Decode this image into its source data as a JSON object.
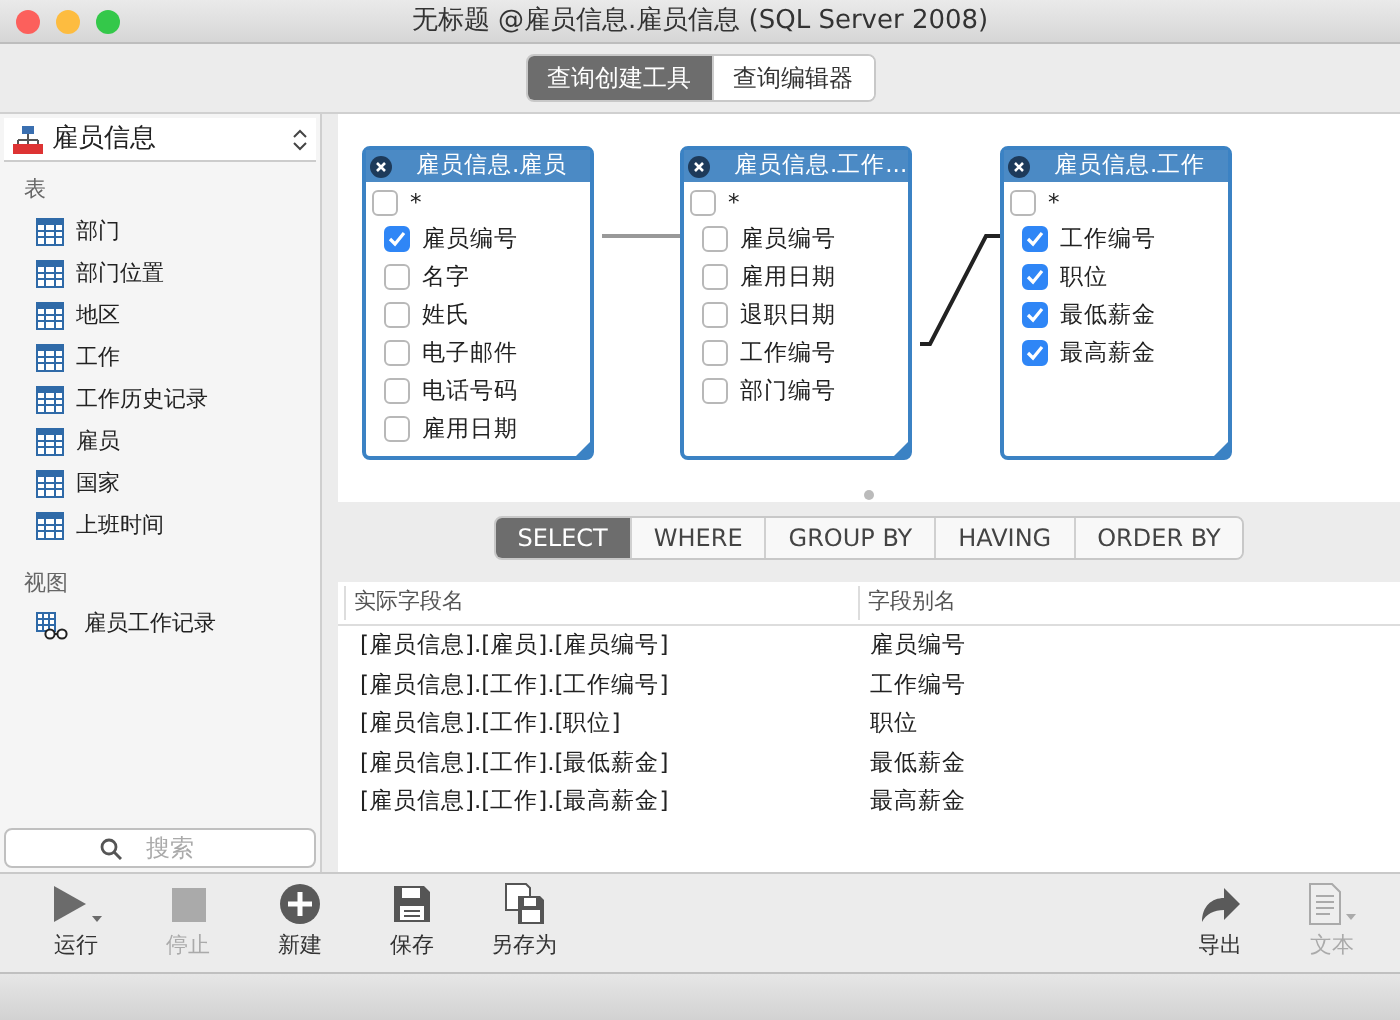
{
  "window": {
    "title": "无标题 @雇员信息.雇员信息 (SQL Server 2008)"
  },
  "mode_tabs": [
    {
      "label": "查询创建工具",
      "selected": true
    },
    {
      "label": "查询编辑器",
      "selected": false
    }
  ],
  "sidebar": {
    "database": "雇员信息",
    "sections": [
      {
        "heading": "表",
        "items": [
          {
            "kind": "table",
            "label": "部门"
          },
          {
            "kind": "table",
            "label": "部门位置"
          },
          {
            "kind": "table",
            "label": "地区"
          },
          {
            "kind": "table",
            "label": "工作"
          },
          {
            "kind": "table",
            "label": "工作历史记录"
          },
          {
            "kind": "table",
            "label": "雇员"
          },
          {
            "kind": "table",
            "label": "国家"
          },
          {
            "kind": "table",
            "label": "上班时间"
          }
        ]
      },
      {
        "heading": "视图",
        "items": [
          {
            "kind": "view",
            "label": "雇员工作记录"
          }
        ]
      }
    ],
    "search": {
      "placeholder": "搜索"
    }
  },
  "diagram": {
    "tables": [
      {
        "title": "雇员信息.雇员",
        "star": "*",
        "star_checked": false,
        "fields": [
          {
            "name": "雇员编号",
            "checked": true
          },
          {
            "name": "名字",
            "checked": false
          },
          {
            "name": "姓氏",
            "checked": false
          },
          {
            "name": "电子邮件",
            "checked": false
          },
          {
            "name": "电话号码",
            "checked": false
          },
          {
            "name": "雇用日期",
            "checked": false
          }
        ]
      },
      {
        "title": "雇员信息.工作...",
        "star": "*",
        "star_checked": false,
        "fields": [
          {
            "name": "雇员编号",
            "checked": false
          },
          {
            "name": "雇用日期",
            "checked": false
          },
          {
            "name": "退职日期",
            "checked": false
          },
          {
            "name": "工作编号",
            "checked": false
          },
          {
            "name": "部门编号",
            "checked": false
          }
        ]
      },
      {
        "title": "雇员信息.工作",
        "star": "*",
        "star_checked": false,
        "fields": [
          {
            "name": "工作编号",
            "checked": true
          },
          {
            "name": "职位",
            "checked": true
          },
          {
            "name": "最低薪金",
            "checked": true
          },
          {
            "name": "最高薪金",
            "checked": true
          }
        ]
      }
    ]
  },
  "clause_tabs": [
    {
      "label": "SELECT",
      "selected": true
    },
    {
      "label": "WHERE",
      "selected": false
    },
    {
      "label": "GROUP BY",
      "selected": false
    },
    {
      "label": "HAVING",
      "selected": false
    },
    {
      "label": "ORDER BY",
      "selected": false
    }
  ],
  "table": {
    "columns": [
      "实际字段名",
      "字段别名"
    ],
    "rows": [
      [
        "[雇员信息].[雇员].[雇员编号]",
        "雇员编号"
      ],
      [
        "[雇员信息].[工作].[工作编号]",
        "工作编号"
      ],
      [
        "[雇员信息].[工作].[职位]",
        "职位"
      ],
      [
        "[雇员信息].[工作].[最低薪金]",
        "最低薪金"
      ],
      [
        "[雇员信息].[工作].[最高薪金]",
        "最高薪金"
      ]
    ]
  },
  "toolbar": {
    "left": [
      {
        "kind": "run",
        "label": "运行",
        "disabled": false
      },
      {
        "kind": "stop",
        "label": "停止",
        "disabled": true
      },
      {
        "kind": "new",
        "label": "新建",
        "disabled": false
      },
      {
        "kind": "save",
        "label": "保存",
        "disabled": false
      },
      {
        "kind": "saveas",
        "label": "另存为",
        "disabled": false
      }
    ],
    "right": [
      {
        "kind": "export",
        "label": "导出",
        "disabled": false
      },
      {
        "kind": "text",
        "label": "文本",
        "disabled": true
      }
    ]
  }
}
